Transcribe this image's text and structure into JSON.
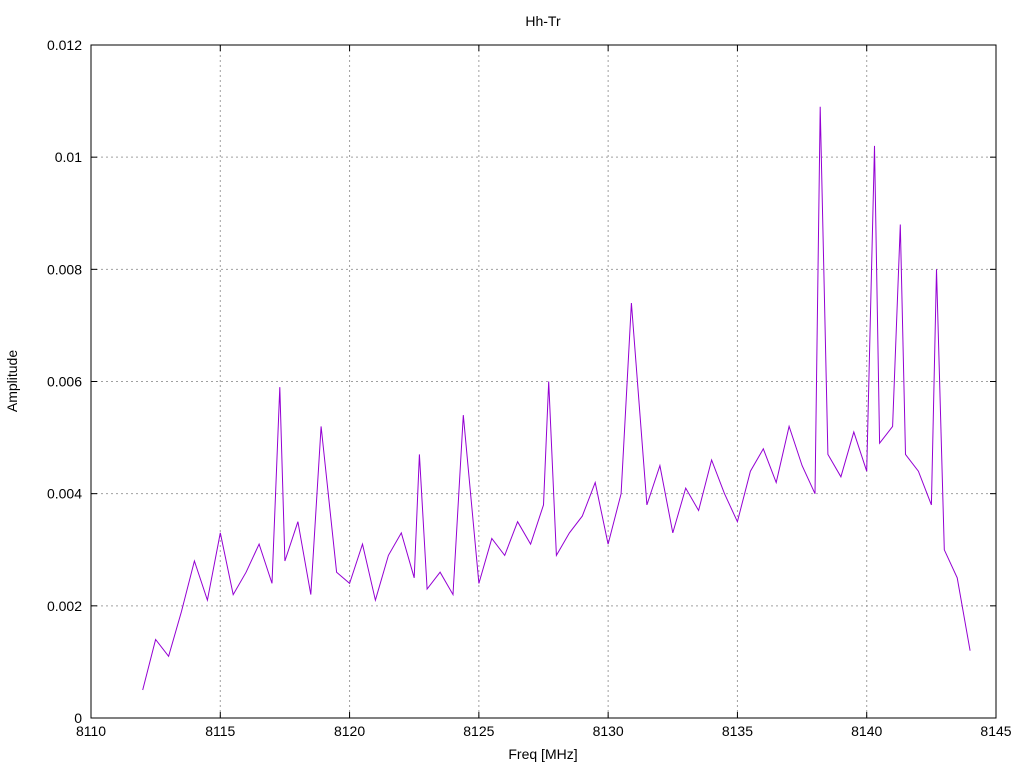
{
  "chart_data": {
    "type": "line",
    "title": "Hh-Tr",
    "xlabel": "Freq [MHz]",
    "ylabel": "Amplitude",
    "xlim": [
      8110,
      8145
    ],
    "ylim": [
      0,
      0.012
    ],
    "xticks": [
      8110,
      8115,
      8120,
      8125,
      8130,
      8135,
      8140,
      8145
    ],
    "yticks": [
      0,
      0.002,
      0.004,
      0.006,
      0.008,
      0.01,
      0.012
    ],
    "ytick_labels": [
      "0",
      "0.002",
      "0.004",
      "0.006",
      "0.008",
      "0.01",
      "0.012"
    ],
    "grid": true,
    "legend": "none",
    "series": [
      {
        "color": "#9400d3",
        "x": [
          8112.0,
          8112.5,
          8113.0,
          8113.5,
          8114.0,
          8114.5,
          8115.0,
          8115.5,
          8116.0,
          8116.5,
          8117.0,
          8117.3,
          8117.5,
          8118.0,
          8118.5,
          8118.9,
          8119.5,
          8120.0,
          8120.5,
          8121.0,
          8121.5,
          8122.0,
          8122.5,
          8122.7,
          8123.0,
          8123.5,
          8124.0,
          8124.4,
          8125.0,
          8125.5,
          8126.0,
          8126.5,
          8127.0,
          8127.5,
          8127.7,
          8128.0,
          8128.5,
          8129.0,
          8129.5,
          8130.0,
          8130.5,
          8130.9,
          8131.5,
          8132.0,
          8132.5,
          8133.0,
          8133.5,
          8134.0,
          8134.5,
          8135.0,
          8135.5,
          8136.0,
          8136.5,
          8137.0,
          8137.5,
          8138.0,
          8138.2,
          8138.5,
          8139.0,
          8139.5,
          8140.0,
          8140.3,
          8140.5,
          8141.0,
          8141.3,
          8141.5,
          8142.0,
          8142.5,
          8142.7,
          8143.0,
          8143.5,
          8144.0
        ],
        "y": [
          0.0005,
          0.0014,
          0.0011,
          0.0019,
          0.0028,
          0.0021,
          0.0033,
          0.0022,
          0.0026,
          0.0031,
          0.0024,
          0.0059,
          0.0028,
          0.0035,
          0.0022,
          0.0052,
          0.0026,
          0.0024,
          0.0031,
          0.0021,
          0.0029,
          0.0033,
          0.0025,
          0.0047,
          0.0023,
          0.0026,
          0.0022,
          0.0054,
          0.0024,
          0.0032,
          0.0029,
          0.0035,
          0.0031,
          0.0038,
          0.006,
          0.0029,
          0.0033,
          0.0036,
          0.0042,
          0.0031,
          0.004,
          0.0074,
          0.0038,
          0.0045,
          0.0033,
          0.0041,
          0.0037,
          0.0046,
          0.004,
          0.0035,
          0.0044,
          0.0048,
          0.0042,
          0.0052,
          0.0045,
          0.004,
          0.0109,
          0.0047,
          0.0043,
          0.0051,
          0.0044,
          0.0102,
          0.0049,
          0.0052,
          0.0088,
          0.0047,
          0.0044,
          0.0038,
          0.008,
          0.003,
          0.0025,
          0.0012
        ]
      }
    ]
  }
}
